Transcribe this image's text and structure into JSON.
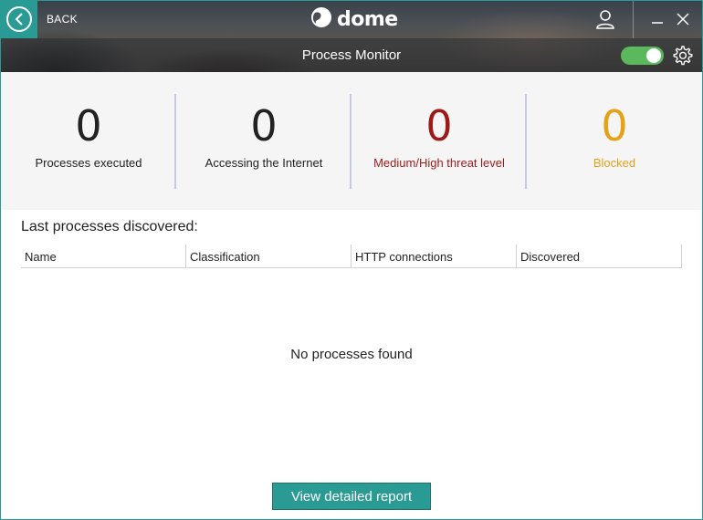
{
  "header": {
    "back_label": "BACK",
    "logo_text": "dome",
    "page_title": "Process Monitor",
    "protection_toggle_on": true
  },
  "stats": [
    {
      "value": "0",
      "label": "Processes executed",
      "color": "#222222"
    },
    {
      "value": "0",
      "label": "Accessing the Internet",
      "color": "#222222"
    },
    {
      "value": "0",
      "label": "Medium/High threat level",
      "color": "#9b1b1b"
    },
    {
      "value": "0",
      "label": "Blocked",
      "color": "#e3a21a"
    }
  ],
  "processes": {
    "title": "Last processes discovered:",
    "columns": [
      "Name",
      "Classification",
      "HTTP connections",
      "Discovered"
    ],
    "rows": [],
    "empty_message": "No processes found"
  },
  "actions": {
    "report_button": "View detailed report"
  },
  "colors": {
    "accent": "#2a9a94",
    "toggle_on": "#5cb85c",
    "threat": "#9b1b1b",
    "blocked": "#e3a21a"
  },
  "icons": [
    "back-arrow-icon",
    "dome-logo-icon",
    "user-icon",
    "minimize-icon",
    "close-icon",
    "gear-icon"
  ]
}
